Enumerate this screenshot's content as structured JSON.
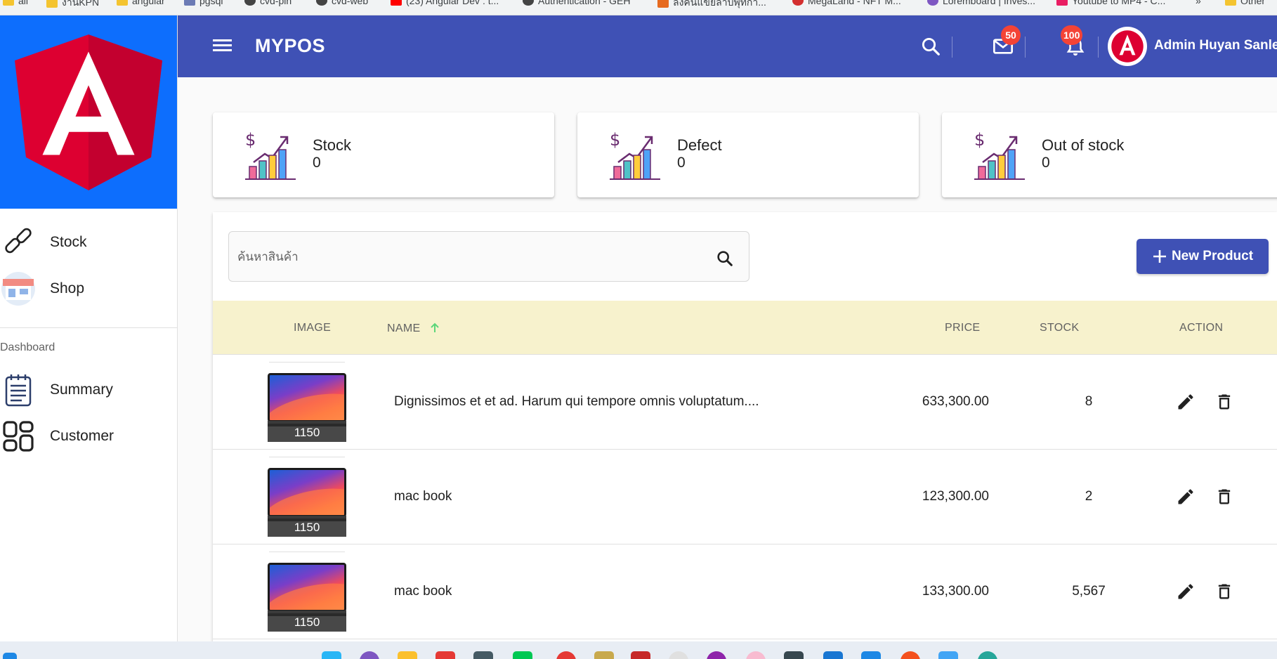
{
  "browser": {
    "bookmarks": [
      {
        "label": "all",
        "color": "#f4c430"
      },
      {
        "label": "งานKPN",
        "color": "#f4c430"
      },
      {
        "label": "angular",
        "color": "#f4c430"
      },
      {
        "label": "pgsql",
        "color": "#6c7bb5"
      },
      {
        "label": "cvd-pin",
        "color": "#444444"
      },
      {
        "label": "cvd-web",
        "color": "#444444"
      },
      {
        "label": "(23) Angular Dev : t...",
        "color": "#ff0000"
      },
      {
        "label": "Authentication - GEH",
        "color": "#444444"
      },
      {
        "label": "ลงคนแขยลาบพุทกา...",
        "color": "#e66a1f"
      },
      {
        "label": "MegaLand - NFT M...",
        "color": "#d32f2f"
      },
      {
        "label": "Loremboard | Inves...",
        "color": "#7e57c2"
      },
      {
        "label": "Youtube to MP4 - C...",
        "color": "#e91e63"
      },
      {
        "label": "»",
        "color": ""
      },
      {
        "label": "Other",
        "color": "#f4c430"
      }
    ]
  },
  "app": {
    "title": "MYPOS",
    "colors": {
      "primary": "#3f51b5",
      "badge": "#f44336",
      "header_bg": "#f7f2cd",
      "logo_bg": "#0d6efd"
    }
  },
  "header": {
    "mail_badge": "50",
    "notification_badge": "100",
    "user_name": "Admin Huyan Sanlee"
  },
  "sidebar": {
    "items": [
      {
        "label": "Stock",
        "icon": "link-icon"
      },
      {
        "label": "Shop",
        "icon": "shop-icon"
      }
    ],
    "section_title": "Dashboard",
    "section_items": [
      {
        "label": "Summary",
        "icon": "notepad-icon"
      },
      {
        "label": "Customer",
        "icon": "dashboard-grid-icon"
      }
    ]
  },
  "stats": [
    {
      "title": "Stock",
      "value": "0",
      "icon": "chart-growth-icon"
    },
    {
      "title": "Defect",
      "value": "0",
      "icon": "chart-growth-icon"
    },
    {
      "title": "Out of stock",
      "value": "0",
      "icon": "chart-growth-icon"
    }
  ],
  "products": {
    "search_placeholder": "ค้นหาสินค้า",
    "new_button_label": "New Product",
    "columns": {
      "image": "IMAGE",
      "name": "NAME",
      "price": "PRICE",
      "stock": "STOCK",
      "action": "ACTION"
    },
    "sort": {
      "column": "name",
      "direction": "asc"
    },
    "rows": [
      {
        "image_label": "1150",
        "name": "Dignissimos et et ad. Harum qui tempore omnis voluptatum....",
        "price": "633,300.00",
        "stock": "8"
      },
      {
        "image_label": "1150",
        "name": "mac book",
        "price": "123,300.00",
        "stock": "2"
      },
      {
        "image_label": "1150",
        "name": "mac book",
        "price": "133,300.00",
        "stock": "5,567"
      }
    ]
  }
}
